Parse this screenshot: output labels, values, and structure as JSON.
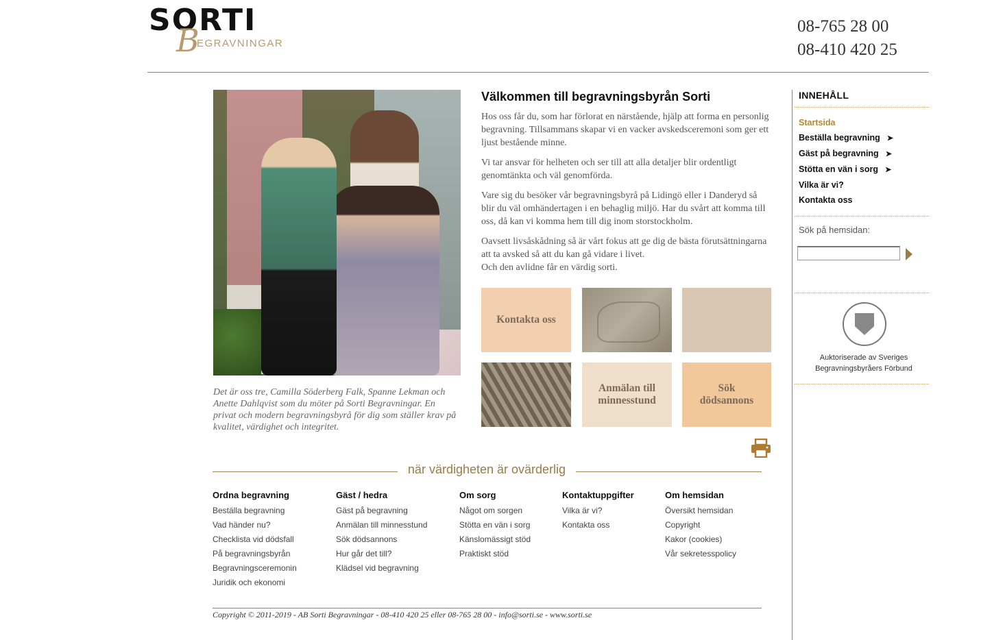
{
  "header": {
    "logo_main": "SORTI",
    "logo_sub_initial": "B",
    "logo_sub": "EGRAVNINGAR",
    "phones": [
      "08-765 28 00",
      "08-410 420 25"
    ]
  },
  "main": {
    "title": "Välkommen till begravningsbyrån Sorti",
    "paragraphs": [
      "Hos oss får du, som har förlorat en närstående, hjälp att forma en personlig begravning. Tillsammans skapar vi en vacker avskedsceremoni som ger ett ljust bestående minne.",
      "Vi tar ansvar för helheten och ser till att alla detaljer blir ordentligt genomtänkta och väl genomförda.",
      "Vare sig du besöker vår begravningsbyrå på Lidingö eller i Danderyd så blir du väl omhändertagen i en behaglig miljö. Har du svårt att komma till oss, då kan vi komma hem till dig inom storstockholm.",
      "Oavsett livsåskådning så är vårt fokus att ge dig de bästa förutsättningarna att ta avsked så att du kan gå vidare i livet.",
      "Och den avlidne får en värdig sorti."
    ],
    "caption": "Det är oss tre, Camilla Söderberg Falk, Spanne Lekman och Anette Dahlqvist som du möter på Sorti Begravningar. En privat och modern begravningsbyrå för dig som ställer krav på kvalitet, värdighet och integritet.",
    "tiles": {
      "contact": "Kontakta oss",
      "memorial_line1": "Anmälan till",
      "memorial_line2": "minnesstund",
      "obit_line1": "Sök",
      "obit_line2": "dödsannons"
    },
    "tagline": "när värdigheten är ovärderlig"
  },
  "footer": {
    "columns": [
      {
        "heading": "Ordna begravning",
        "links": [
          "Beställa begravning",
          "Vad händer nu?",
          "Checklista vid dödsfall",
          "På begravningsbyrån",
          "Begravningsceremonin",
          "Juridik och ekonomi"
        ]
      },
      {
        "heading": "Gäst / hedra",
        "links": [
          "Gäst på begravning",
          "Anmälan till minnesstund",
          "Sök dödsannons",
          "Hur går det till?",
          "Klädsel vid begravning"
        ]
      },
      {
        "heading": "Om sorg",
        "links": [
          "Något om sorgen",
          "Stötta en vän i sorg",
          "Känslomässigt stöd",
          "Praktiskt stöd"
        ]
      },
      {
        "heading": "Kontaktuppgifter",
        "links": [
          "Vilka är vi?",
          "Kontakta oss"
        ]
      },
      {
        "heading": "Om hemsidan",
        "links": [
          "Översikt hemsidan",
          "Copyright",
          "Kakor (cookies)",
          "Vår sekretesspolicy"
        ]
      }
    ],
    "copyright": "Copyright © 2011-2019 - AB Sorti Begravningar - 08-410 420 25 eller 08-765 28 00 - info@sorti.se - www.sorti.se"
  },
  "sidebar": {
    "title": "INNEHÅLL",
    "items": [
      "Startsida",
      "Beställa begravning",
      "Gäst på begravning",
      "Stötta en vän i sorg",
      "Vilka är vi?",
      "Kontakta oss"
    ],
    "arrow": "➤",
    "search_label": "Sök på hemsidan:",
    "search_placeholder": "",
    "seal_line1": "Auktoriserade av Sveriges",
    "seal_line2": "Begravningsbyråers Förbund"
  },
  "colors": {
    "accent": "#9c8452",
    "active": "#b8852f",
    "logo_gold": "#b99a6c"
  },
  "icons": {
    "print": "printer-icon",
    "search_go": "play-arrow-icon"
  }
}
